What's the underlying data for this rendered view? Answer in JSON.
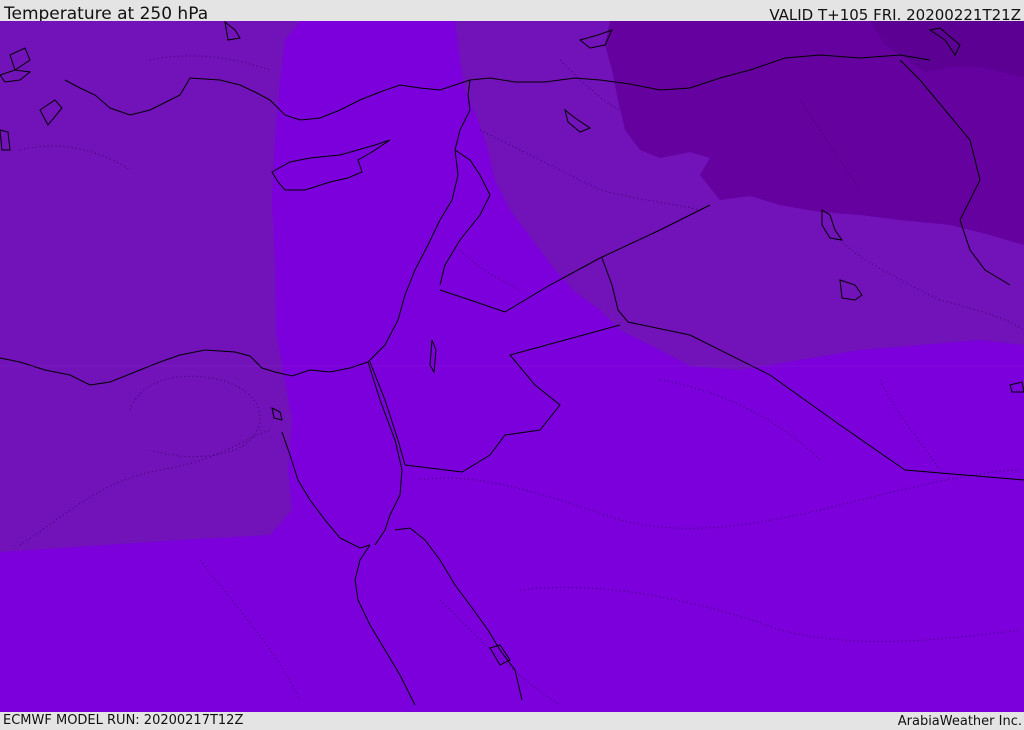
{
  "header": {
    "title": "Temperature at 250 hPa",
    "valid": "VALID T+105 FRI. 20200221T21Z"
  },
  "footer": {
    "model_run": "ECMWF MODEL RUN: 20200217T12Z",
    "credit": "ArabiaWeather Inc."
  },
  "map": {
    "colors": {
      "band_light": "#7b00dc",
      "band_mid": "#7212b9",
      "band_dark": "#65019f",
      "band_darkest": "#5c0094",
      "coastline": "#000000"
    }
  }
}
